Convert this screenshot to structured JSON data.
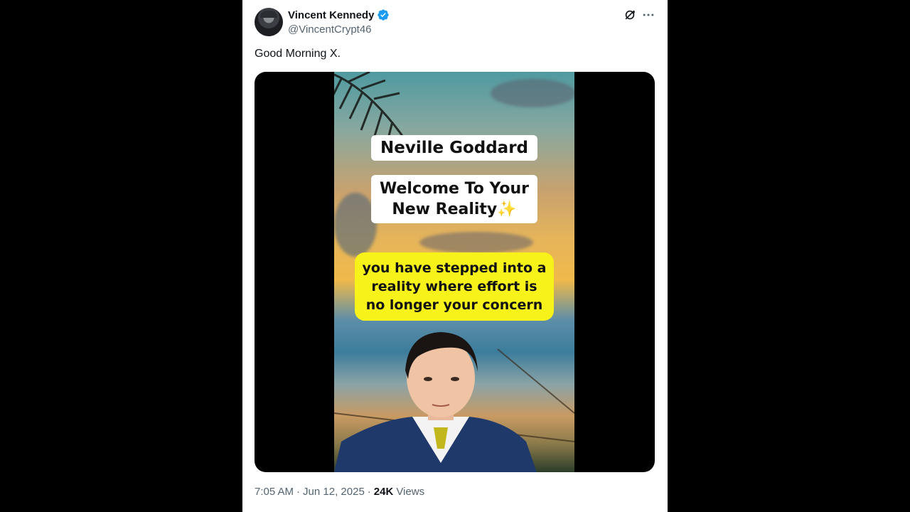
{
  "author": {
    "name": "Vincent Kennedy",
    "handle": "@VincentCrypt46",
    "verified": true
  },
  "tweet": {
    "text": "Good Morning X.",
    "time": "7:05 AM",
    "separator": "·",
    "date": "Jun 12, 2025",
    "views_count": "24K",
    "views_label": "Views"
  },
  "media": {
    "caption_title": "Neville Goddard",
    "caption_welcome_line1": "Welcome To Your",
    "caption_welcome_line2": "New Reality✨",
    "caption_quote": "you have stepped into a reality where effort is no longer your concern"
  },
  "icons": {
    "verified": "verified-badge-icon",
    "grok": "grok-icon",
    "more": "more-options-icon"
  },
  "colors": {
    "verified_blue": "#1d9bf0",
    "caption_yellow": "#f7f21a",
    "text_secondary": "#536471"
  }
}
